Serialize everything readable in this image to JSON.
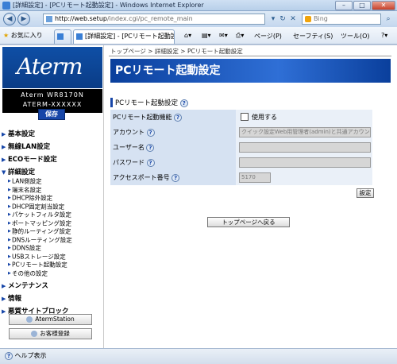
{
  "window": {
    "title": "[詳細設定] - [PCリモート起動設定] - Windows Internet Explorer",
    "min_label": "–",
    "max_label": "□",
    "close_label": "✕"
  },
  "address": {
    "url_host": "http://web.setup",
    "url_path": "/index.cgi/pc_remote_main",
    "search_placeholder": "Bing"
  },
  "favorites": {
    "label": "お気に入り",
    "tab_label": "[詳細設定] - [PCリモート起動設定]",
    "commands": [
      "ページ(P)",
      "セーフティ(S)",
      "ツール(O)"
    ]
  },
  "sidebar": {
    "logo": "Aterm",
    "model_line1": "Aterm WR8170N",
    "model_line2": "ATERM-XXXXXX",
    "save_label": "保存",
    "menu_top": [
      "基本設定",
      "無線LAN設定",
      "ECOモード設定",
      "詳細設定"
    ],
    "sub_items": [
      "LAN側設定",
      "端末名設定",
      "DHCP除外設定",
      "DHCP固定割当設定",
      "パケットフィルタ設定",
      "ポートマッピング設定",
      "静的ルーティング設定",
      "DNSルーティング設定",
      "DDNS設定",
      "USBストレージ設定",
      "PCリモート起動設定",
      "その他の設定"
    ],
    "menu_bottom": [
      "メンテナンス",
      "情報",
      "悪質サイトブロック"
    ],
    "aterm_station_label": "AtermStation",
    "register_label": "お客様登録",
    "help_label": "ヘルプ表示"
  },
  "main": {
    "breadcrumb": "トップページ > 詳細設定 > PCリモート起動設定",
    "header": "PCリモート起動設定",
    "section_title": "PCリモート起動設定",
    "rows": [
      {
        "label": "PCリモート起動機能",
        "value": "使用する"
      },
      {
        "label": "アカウント",
        "value": "クイック設定Web用管理者(admin)と共通アカウント"
      },
      {
        "label": "ユーザー名",
        "value": ""
      },
      {
        "label": "パスワード",
        "value": ""
      },
      {
        "label": "アクセスポート番号",
        "value": "5170"
      }
    ],
    "set_label": "設定",
    "top_page_label": "トップページへ戻る"
  }
}
